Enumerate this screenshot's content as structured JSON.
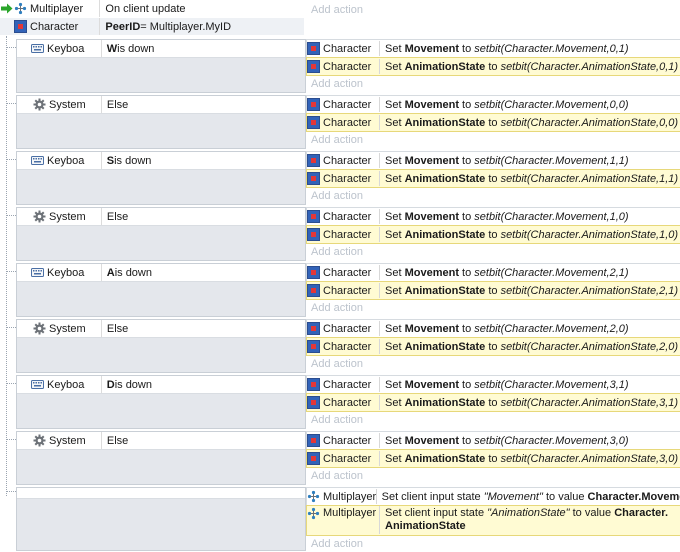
{
  "top_event": {
    "cond1": {
      "object": "Multiplayer",
      "text": "On client update"
    },
    "cond2": {
      "object": "Character",
      "text_bold": "PeerID",
      "text_rest": " = Multiplayer.MyID"
    },
    "add_action": "Add action"
  },
  "events": [
    {
      "object": "Keyboard",
      "icon": "keyboard-icon",
      "cond_key": "W",
      "cond_rest": " is down",
      "actions": [
        {
          "object": "Character",
          "pre": "Set ",
          "bold": "Movement",
          "mid": " to ",
          "italic": "setbit(Character.Movement,0,1)"
        },
        {
          "object": "Character",
          "pre": "Set ",
          "bold": "AnimationState",
          "mid": " to ",
          "italic": "setbit(Character.AnimationState,0,1)"
        }
      ]
    },
    {
      "object": "System",
      "icon": "gear-icon",
      "cond_key": "",
      "cond_rest": "Else",
      "actions": [
        {
          "object": "Character",
          "pre": "Set ",
          "bold": "Movement",
          "mid": " to ",
          "italic": "setbit(Character.Movement,0,0)"
        },
        {
          "object": "Character",
          "pre": "Set ",
          "bold": "AnimationState",
          "mid": " to ",
          "italic": "setbit(Character.AnimationState,0,0)"
        }
      ]
    },
    {
      "object": "Keyboard",
      "icon": "keyboard-icon",
      "cond_key": "S",
      "cond_rest": " is down",
      "actions": [
        {
          "object": "Character",
          "pre": "Set ",
          "bold": "Movement",
          "mid": " to ",
          "italic": "setbit(Character.Movement,1,1)"
        },
        {
          "object": "Character",
          "pre": "Set ",
          "bold": "AnimationState",
          "mid": " to ",
          "italic": "setbit(Character.AnimationState,1,1)"
        }
      ]
    },
    {
      "object": "System",
      "icon": "gear-icon",
      "cond_key": "",
      "cond_rest": "Else",
      "actions": [
        {
          "object": "Character",
          "pre": "Set ",
          "bold": "Movement",
          "mid": " to ",
          "italic": "setbit(Character.Movement,1,0)"
        },
        {
          "object": "Character",
          "pre": "Set ",
          "bold": "AnimationState",
          "mid": " to ",
          "italic": "setbit(Character.AnimationState,1,0)"
        }
      ]
    },
    {
      "object": "Keyboard",
      "icon": "keyboard-icon",
      "cond_key": "A",
      "cond_rest": " is down",
      "actions": [
        {
          "object": "Character",
          "pre": "Set ",
          "bold": "Movement",
          "mid": " to ",
          "italic": "setbit(Character.Movement,2,1)"
        },
        {
          "object": "Character",
          "pre": "Set ",
          "bold": "AnimationState",
          "mid": " to ",
          "italic": "setbit(Character.AnimationState,2,1)"
        }
      ]
    },
    {
      "object": "System",
      "icon": "gear-icon",
      "cond_key": "",
      "cond_rest": "Else",
      "actions": [
        {
          "object": "Character",
          "pre": "Set ",
          "bold": "Movement",
          "mid": " to ",
          "italic": "setbit(Character.Movement,2,0)"
        },
        {
          "object": "Character",
          "pre": "Set ",
          "bold": "AnimationState",
          "mid": " to ",
          "italic": "setbit(Character.AnimationState,2,0)"
        }
      ]
    },
    {
      "object": "Keyboard",
      "icon": "keyboard-icon",
      "cond_key": "D",
      "cond_rest": " is down",
      "actions": [
        {
          "object": "Character",
          "pre": "Set ",
          "bold": "Movement",
          "mid": " to ",
          "italic": "setbit(Character.Movement,3,1)"
        },
        {
          "object": "Character",
          "pre": "Set ",
          "bold": "AnimationState",
          "mid": " to ",
          "italic": "setbit(Character.AnimationState,3,1)"
        }
      ]
    },
    {
      "object": "System",
      "icon": "gear-icon",
      "cond_key": "",
      "cond_rest": "Else",
      "actions": [
        {
          "object": "Character",
          "pre": "Set ",
          "bold": "Movement",
          "mid": " to ",
          "italic": "setbit(Character.Movement,3,0)"
        },
        {
          "object": "Character",
          "pre": "Set ",
          "bold": "AnimationState",
          "mid": " to ",
          "italic": "setbit(Character.AnimationState,3,0)"
        }
      ]
    }
  ],
  "add_action_label": "Add action",
  "final_event": {
    "actions": [
      {
        "object": "Multiplayer",
        "pre": "Set client input state ",
        "italic": "\"Movement\"",
        "mid": " to value ",
        "bold": "Character.Movement"
      },
      {
        "object": "Multiplayer",
        "pre": "Set client input state ",
        "italic": "\"AnimationState\"",
        "mid": " to value ",
        "bold": "Character.",
        "bold2": "AnimationState"
      }
    ],
    "add_action": "Add action"
  },
  "colors": {
    "action_yellow": "#fffbd3",
    "event_box": "#e4e7ec",
    "add_action_text": "#bcc3cc",
    "arrow_green": "#2aa52a"
  }
}
